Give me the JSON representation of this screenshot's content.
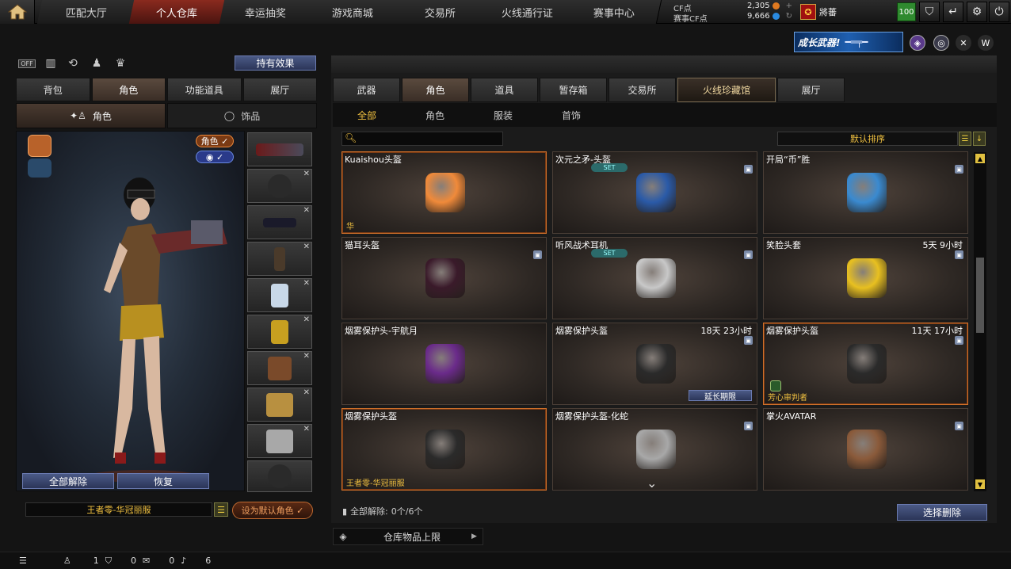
{
  "nav": {
    "tabs": [
      {
        "label": "匹配大厅"
      },
      {
        "label": "个人仓库"
      },
      {
        "label": "幸运抽奖"
      },
      {
        "label": "游戏商城"
      },
      {
        "label": "交易所"
      },
      {
        "label": "火线通行证"
      },
      {
        "label": "赛事中心"
      }
    ],
    "active_tab": "个人仓库"
  },
  "currency": {
    "cf_label": "CF点",
    "cf_value": "2,305",
    "event_cf_label": "赛事CF点",
    "event_cf_value": "9,666"
  },
  "player": {
    "rank_name": "將蕃",
    "level": "100"
  },
  "banner": {
    "grow_weapon": "成长武器!"
  },
  "left": {
    "effect_button": "持有效果",
    "tabs": [
      {
        "label": "背包"
      },
      {
        "label": "角色"
      },
      {
        "label": "功能道具"
      },
      {
        "label": "展厅"
      }
    ],
    "subtabs": [
      {
        "label": "角色"
      },
      {
        "label": "饰品"
      }
    ],
    "tag_role": "角色 ✓",
    "tag_eye": "✓",
    "unequip_all": "全部解除",
    "restore": "恢复",
    "char_name": "王者零-华冠丽服",
    "set_default": "设为默认角色"
  },
  "right": {
    "tabs": [
      {
        "label": "武器"
      },
      {
        "label": "角色"
      },
      {
        "label": "道具"
      },
      {
        "label": "暂存箱"
      },
      {
        "label": "交易所"
      },
      {
        "label": "火线珍藏馆"
      },
      {
        "label": "展厅"
      }
    ],
    "filters": [
      {
        "label": "全部"
      },
      {
        "label": "角色"
      },
      {
        "label": "服装"
      },
      {
        "label": "首饰"
      }
    ],
    "sort_label": "默认排序",
    "items": [
      {
        "name": "Kuaishou头盔",
        "timer": "",
        "set": "",
        "foot": "华",
        "color": "#f08a3a"
      },
      {
        "name": "次元之矛-头盔",
        "timer": "",
        "set": "SET",
        "foot": "",
        "color": "#2a5aa8"
      },
      {
        "name": "开局“币”胜",
        "timer": "",
        "set": "",
        "foot": "",
        "color": "#3a8ad0"
      },
      {
        "name": "猫耳头盔",
        "timer": "",
        "set": "",
        "foot": "",
        "color": "#3a1a2a"
      },
      {
        "name": "听风战术耳机",
        "timer": "",
        "set": "SET",
        "foot": "",
        "color": "#c8c8c8"
      },
      {
        "name": "笑脸头套",
        "timer": "5天 9小时",
        "set": "",
        "foot": "",
        "color": "#e8c020"
      },
      {
        "name": "烟雾保护头-宇航月",
        "timer": "",
        "set": "",
        "foot": "",
        "color": "#6a2a8a"
      },
      {
        "name": "烟雾保护头盔",
        "timer": "18天 23小时",
        "set": "",
        "foot": "",
        "color": "#2a2a2a"
      },
      {
        "name": "烟雾保护头盔",
        "timer": "11天 17小时",
        "set": "",
        "foot": "芳心审判者",
        "color": "#2a2a2a"
      },
      {
        "name": "烟雾保护头盔",
        "timer": "",
        "set": "",
        "foot": "王者零-华冠丽服",
        "color": "#2a2a2a"
      },
      {
        "name": "烟雾保护头盔-化蛇",
        "timer": "",
        "set": "",
        "foot": "",
        "color": "#a8a8a8"
      },
      {
        "name": "掌火AVATAR",
        "timer": "",
        "set": "",
        "foot": "",
        "color": "#8a5a3a"
      }
    ],
    "extend_label": "延长期限",
    "unequip_count_label": "全部解除:",
    "unequip_count_value": "0个/6个",
    "select_delete": "选择删除",
    "storage_limit": "仓库物品上限"
  },
  "bottom": {
    "count_a": "1",
    "count_b": "0",
    "count_c": "0",
    "count_d": "6"
  }
}
